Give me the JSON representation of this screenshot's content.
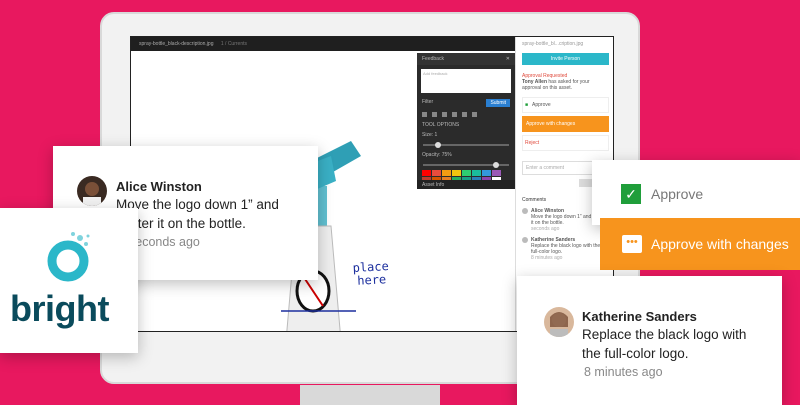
{
  "editor": {
    "filename": "spray-bottle_black-description.jpg",
    "filename_suffix": "1 / Currents",
    "handwriting": [
      "place",
      "here"
    ]
  },
  "feedback_panel": {
    "title": "Feedback",
    "textarea_placeholder": "Add feedback",
    "filter_label": "Filter",
    "submit_label": "Submit",
    "tool_options_label": "TOOL OPTIONS",
    "size_label": "Size: 1",
    "opacity_label": "Opacity: 75%",
    "asset_info_label": "Asset Info",
    "palette": [
      "#ff0000",
      "#e84c3d",
      "#f39c12",
      "#f1c40f",
      "#2ecc71",
      "#1abc9c",
      "#3498db",
      "#9b59b6",
      "#c0392b",
      "#d35400",
      "#e67e22",
      "#27ae60",
      "#16a085",
      "#2980b9",
      "#8e44ad",
      "#ffffff"
    ]
  },
  "right_panel": {
    "file": "spray-bottle_bl...cription.jpg",
    "invite_label": "Invite Person",
    "approval_requested_title": "Approval Requested",
    "approval_requested_name": "Tony Allen",
    "approval_requested_body": "has asked for your approval on this asset.",
    "approve_label": "Approve",
    "approve_changes_label": "Approve with changes",
    "reject_label": "Reject",
    "comment_placeholder": "Enter a comment",
    "comments_label": "Comments",
    "comments": [
      {
        "name": "Alice Winston",
        "text": "Move the logo down 1” and center it on the bottle.",
        "time": "seconds ago"
      },
      {
        "name": "Katherine Sanders",
        "text": "Replace the black logo with the full-color logo.",
        "time": "8 minutes ago"
      }
    ]
  },
  "alice_card": {
    "name": "Alice Winston",
    "message_line1": "Move the logo down 1” and",
    "message_line2": "center it on the bottle.",
    "time": "seconds ago"
  },
  "katherine_card": {
    "name": "Katherine Sanders",
    "message_line1": "Replace the black logo with",
    "message_line2": "the full-color logo.",
    "time": "8 minutes ago"
  },
  "bright": {
    "logo_text": "bright"
  },
  "approve_card": {
    "approve_label": "Approve",
    "approve_changes_label": "Approve with changes"
  },
  "colors": {
    "background": "#e8185f",
    "approve_green": "#1f9e3a",
    "approve_changes_orange": "#f7941d",
    "brand_teal": "#0a4b5c"
  }
}
